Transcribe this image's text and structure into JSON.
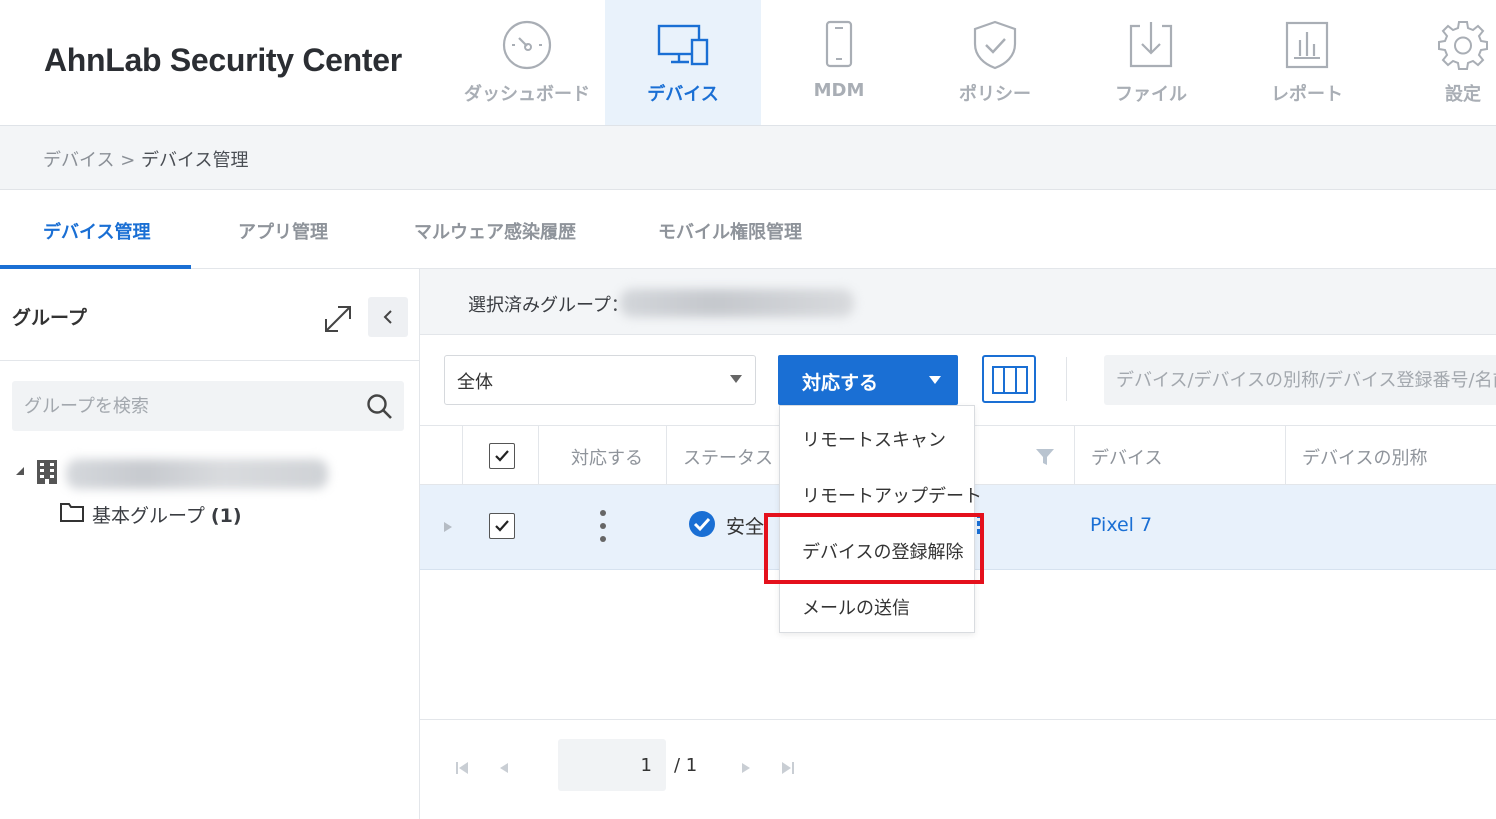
{
  "app": {
    "title": "AhnLab Security Center"
  },
  "nav": {
    "items": [
      {
        "label": "ダッシュボード",
        "icon": "dashboard-gauge-icon",
        "active": false
      },
      {
        "label": "デバイス",
        "icon": "devices-icon",
        "active": true
      },
      {
        "label": "MDM",
        "icon": "mobile-phone-icon",
        "active": false
      },
      {
        "label": "ポリシー",
        "icon": "shield-check-icon",
        "active": false
      },
      {
        "label": "ファイル",
        "icon": "file-download-icon",
        "active": false
      },
      {
        "label": "レポート",
        "icon": "report-chart-icon",
        "active": false
      },
      {
        "label": "設定",
        "icon": "gear-icon",
        "active": false
      }
    ]
  },
  "breadcrumb": {
    "parent": "デバイス",
    "separator": ">",
    "current": "デバイス管理"
  },
  "tabs": [
    {
      "label": "デバイス管理",
      "active": true
    },
    {
      "label": "アプリ管理",
      "active": false
    },
    {
      "label": "マルウェア感染履歴",
      "active": false
    },
    {
      "label": "モバイル権限管理",
      "active": false
    }
  ],
  "group_panel": {
    "title": "グループ",
    "search_placeholder": "グループを検索",
    "basic_group_label": "基本グループ",
    "basic_group_count": "(1)"
  },
  "main": {
    "selected_group_label": "選択済みグループ：",
    "filter_value": "全体",
    "action_button_label": "対応する",
    "search_placeholder": "デバイス/デバイスの別称/デバイス登録番号/名前で"
  },
  "table": {
    "columns": [
      "対応する",
      "ステータス",
      "デバイス",
      "デバイスの別称"
    ],
    "rows": [
      {
        "status": "安全",
        "device": "Pixel 7",
        "alias": "",
        "checked": true
      }
    ]
  },
  "pagination": {
    "current_page": "1",
    "total": "/ 1"
  },
  "action_menu": {
    "items": [
      "リモートスキャン",
      "リモートアップデート",
      "デバイスの登録解除",
      "メールの送信"
    ],
    "highlighted": "デバイスの登録解除"
  },
  "colors": {
    "accent": "#1a6fd4",
    "highlight": "#e4101c",
    "row_selected": "#e8f1fb",
    "nav_active_bg": "#e9f2fb"
  }
}
